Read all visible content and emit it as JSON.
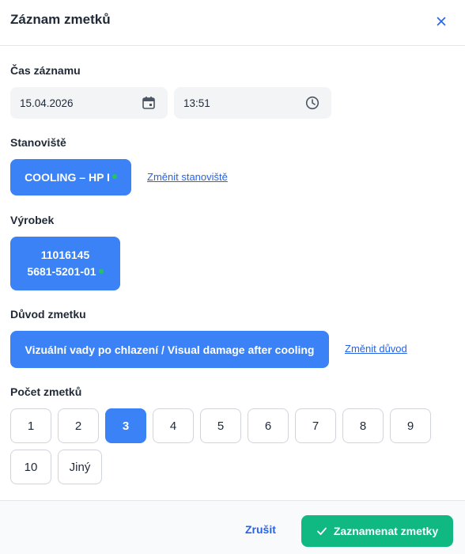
{
  "dialog": {
    "title": "Záznam zmetků"
  },
  "time": {
    "label": "Čas záznamu",
    "date": "15.04.2026",
    "time": "13:51"
  },
  "station": {
    "label": "Stanoviště",
    "value": "COOLING – HP I",
    "change_link": "Změnit stanoviště"
  },
  "product": {
    "label": "Výrobek",
    "code": "11016145",
    "variant": "5681-5201-01"
  },
  "reason": {
    "label": "Důvod zmetku",
    "value": "Vizuální vady po chlazení / Visual damage after cooling",
    "change_link": "Změnit důvod"
  },
  "count": {
    "label": "Počet zmetků",
    "options": [
      "1",
      "2",
      "3",
      "4",
      "5",
      "6",
      "7",
      "8",
      "9",
      "10",
      "Jiný"
    ],
    "selected": "3"
  },
  "footer": {
    "cancel_label": "Zrušit",
    "submit_label": "Zaznamenat zmetky"
  },
  "colors": {
    "primary": "#3b82f6",
    "success": "#10b981",
    "indicator": "#22c55e"
  }
}
